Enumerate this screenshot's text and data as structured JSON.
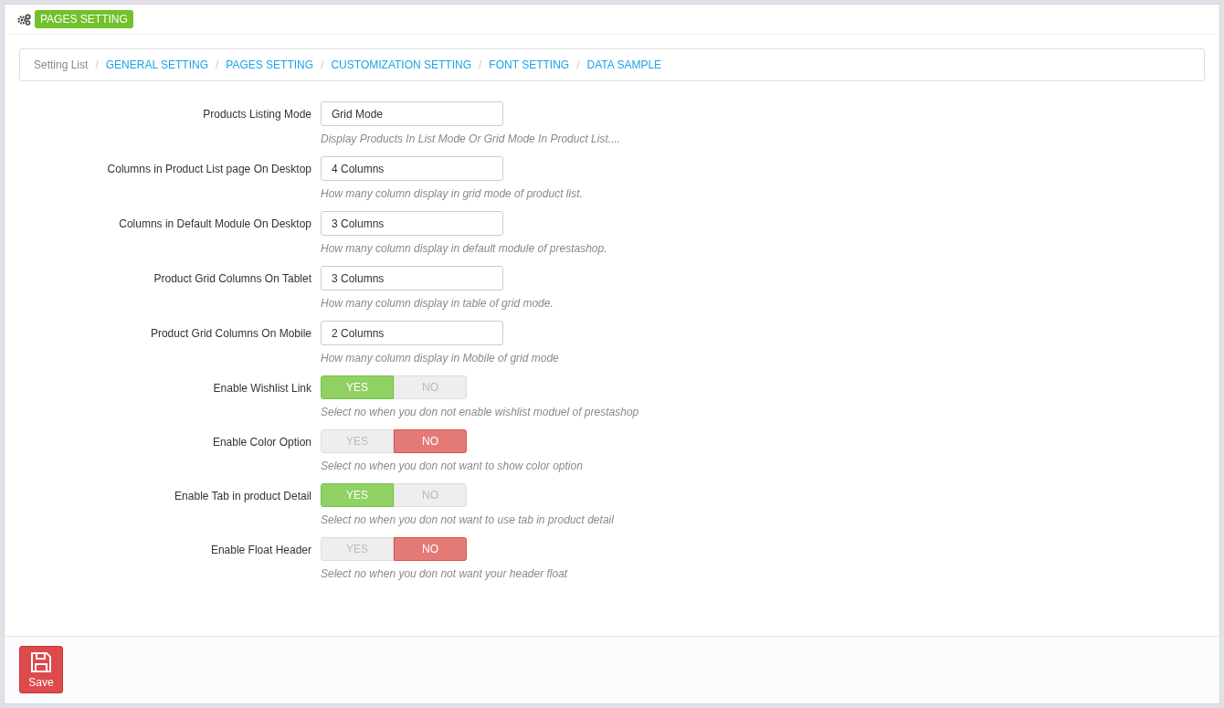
{
  "header": {
    "title": "PAGES SETTING"
  },
  "breadcrumb": [
    {
      "label": "Setting List",
      "kind": "root"
    },
    {
      "label": "GENERAL SETTING",
      "kind": "link"
    },
    {
      "label": "PAGES SETTING",
      "kind": "link"
    },
    {
      "label": "CUSTOMIZATION SETTING",
      "kind": "link"
    },
    {
      "label": "FONT SETTING",
      "kind": "link"
    },
    {
      "label": "DATA SAMPLE",
      "kind": "link"
    }
  ],
  "separator": "/",
  "fields": [
    {
      "kind": "select",
      "label": "Products Listing Mode",
      "value": "Grid Mode",
      "help": "Display Products In List Mode Or Grid Mode In Product List...."
    },
    {
      "kind": "select",
      "label": "Columns in Product List page On Desktop",
      "value": "4 Columns",
      "help": "How many column display in grid mode of product list."
    },
    {
      "kind": "select",
      "label": "Columns in Default Module On Desktop",
      "value": "3 Columns",
      "help": "How many column display in default module of prestashop."
    },
    {
      "kind": "select",
      "label": "Product Grid Columns On Tablet",
      "value": "3 Columns",
      "help": "How many column display in table of grid mode."
    },
    {
      "kind": "select",
      "label": "Product Grid Columns On Mobile",
      "value": "2 Columns",
      "help": "How many column display in Mobile of grid mode"
    },
    {
      "kind": "switch",
      "label": "Enable Wishlist Link",
      "options": [
        {
          "label": "YES",
          "selected": true
        },
        {
          "label": "NO",
          "selected": false
        }
      ],
      "help": "Select no when you don not enable wishlist moduel of prestashop"
    },
    {
      "kind": "switch",
      "label": "Enable Color Option",
      "options": [
        {
          "label": "YES",
          "selected": false
        },
        {
          "label": "NO",
          "selected": true
        }
      ],
      "help": "Select no when you don not want to show color option"
    },
    {
      "kind": "switch",
      "label": "Enable Tab in product Detail",
      "options": [
        {
          "label": "YES",
          "selected": true
        },
        {
          "label": "NO",
          "selected": false
        }
      ],
      "help": "Select no when you don not want to use tab in product detail"
    },
    {
      "kind": "switch",
      "label": "Enable Float Header",
      "options": [
        {
          "label": "YES",
          "selected": false
        },
        {
          "label": "NO",
          "selected": true
        }
      ],
      "help": "Select no when you don not want your header float"
    }
  ],
  "save": {
    "label": "Save"
  }
}
